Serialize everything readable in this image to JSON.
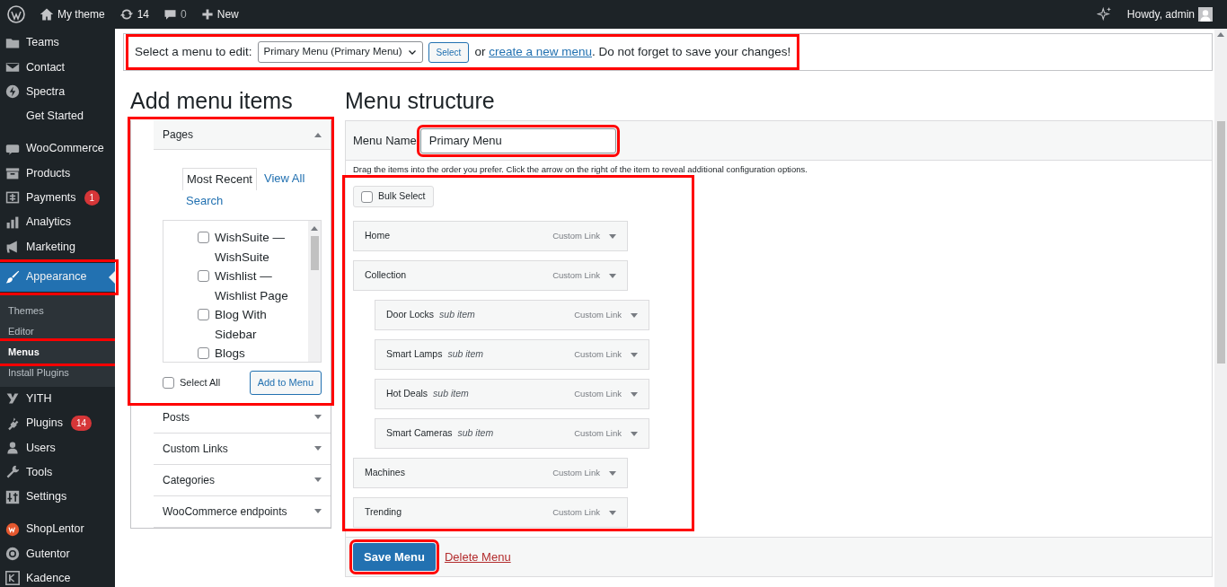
{
  "admin_bar": {
    "site_name": "My theme",
    "updates": "14",
    "comments": "0",
    "new_label": "New",
    "greeting": "Howdy, admin"
  },
  "sidebar": {
    "groups": [
      {
        "items": [
          {
            "label": "Teams",
            "active": false,
            "highlighted": false
          },
          {
            "label": "Contact",
            "active": false,
            "highlighted": false
          },
          {
            "label": "Spectra",
            "active": false,
            "highlighted": false
          },
          {
            "label": "Get Started",
            "active": false,
            "highlighted": false
          }
        ]
      },
      {
        "items": [
          {
            "label": "WooCommerce",
            "active": false,
            "highlighted": false
          },
          {
            "label": "Products",
            "active": false,
            "highlighted": false
          },
          {
            "label": "Payments",
            "badge": "1",
            "active": false,
            "highlighted": false
          },
          {
            "label": "Analytics",
            "active": false,
            "highlighted": false
          },
          {
            "label": "Marketing",
            "active": false,
            "highlighted": false
          },
          {
            "label": "Appearance",
            "active": true,
            "highlighted": true,
            "children": [
              {
                "label": "Themes",
                "selected": false,
                "highlighted": false
              },
              {
                "label": "Editor",
                "selected": false,
                "highlighted": false
              },
              {
                "label": "Menus",
                "selected": true,
                "highlighted": true
              },
              {
                "label": "Install Plugins",
                "selected": false,
                "highlighted": false
              }
            ]
          },
          {
            "label": "YITH",
            "active": false,
            "highlighted": false
          },
          {
            "label": "Plugins",
            "badge": "14",
            "active": false,
            "highlighted": false
          },
          {
            "label": "Users",
            "active": false,
            "highlighted": false
          },
          {
            "label": "Tools",
            "active": false,
            "highlighted": false
          },
          {
            "label": "Settings",
            "active": false,
            "highlighted": false
          }
        ]
      },
      {
        "items": [
          {
            "label": "ShopLentor",
            "active": false,
            "highlighted": false
          },
          {
            "label": "Gutentor",
            "active": false,
            "highlighted": false
          },
          {
            "label": "Kadence",
            "active": false,
            "highlighted": false
          }
        ]
      }
    ]
  },
  "menu_select": {
    "highlighted": true,
    "label": "Select a menu to edit:",
    "value": "Primary Menu (Primary Menu)",
    "button": "Select",
    "text_before": "or ",
    "link": "create a new menu",
    "text_after": ". Do not forget to save your changes!"
  },
  "add_items": {
    "heading": "Add menu items",
    "sections": [
      {
        "title": "Pages",
        "expanded": true,
        "highlighted": true,
        "tabs": [
          {
            "label": "Most Recent",
            "selected": true
          },
          {
            "label": "View All",
            "selected": false
          },
          {
            "label": "Search",
            "selected": false
          }
        ],
        "options": [
          {
            "label": "WishSuite — WishSuite",
            "checked": false
          },
          {
            "label": "Wishlist — Wishlist Page",
            "checked": false
          },
          {
            "label": "Blog With Sidebar",
            "checked": false
          },
          {
            "label": "Blogs",
            "checked": false
          }
        ],
        "select_all": {
          "label": "Select All",
          "checked": false
        },
        "add_button": "Add to Menu"
      },
      {
        "title": "Posts",
        "expanded": false,
        "highlighted": false
      },
      {
        "title": "Custom Links",
        "expanded": false,
        "highlighted": false
      },
      {
        "title": "Categories",
        "expanded": false,
        "highlighted": false
      },
      {
        "title": "WooCommerce endpoints",
        "expanded": false,
        "highlighted": false
      }
    ]
  },
  "menu_structure": {
    "heading": "Menu structure",
    "name_label": "Menu Name",
    "name_value": "Primary Menu",
    "name_highlighted": true,
    "instructions": "Drag the items into the order you prefer. Click the arrow on the right of the item to reveal additional configuration options.",
    "list_highlighted": true,
    "bulk_select": {
      "label": "Bulk Select",
      "checked": false
    },
    "items": [
      {
        "title": "Home",
        "type": "Custom Link"
      },
      {
        "title": "Collection",
        "type": "Custom Link",
        "children": [
          {
            "title": "Door Locks",
            "note": "sub item",
            "type": "Custom Link"
          },
          {
            "title": "Smart Lamps",
            "note": "sub item",
            "type": "Custom Link"
          },
          {
            "title": "Hot Deals",
            "note": "sub item",
            "type": "Custom Link"
          },
          {
            "title": "Smart Cameras",
            "note": "sub item",
            "type": "Custom Link"
          }
        ]
      },
      {
        "title": "Machines",
        "type": "Custom Link"
      },
      {
        "title": "Trending",
        "type": "Custom Link"
      }
    ],
    "save_button": "Save Menu",
    "save_highlighted": true,
    "delete_link": "Delete Menu"
  }
}
